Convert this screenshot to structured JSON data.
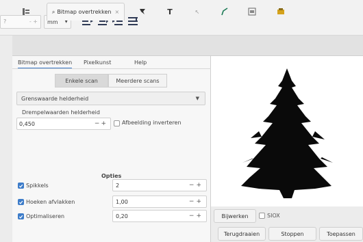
{
  "toolbar": {
    "unit_spin_value": "?",
    "unit_select": "mm",
    "icons": [
      "align-left-icon",
      "align-center-icon",
      "align-right-icon",
      "align-justify-icon"
    ]
  },
  "tabs": {
    "active_label": "Bitmap overtrekken",
    "icons": [
      "layers-icon",
      "trace-bitmap-icon",
      "brush-icon",
      "text-tool-icon",
      "pointer-icon",
      "pen-icon",
      "dialog-icon",
      "paint-icon"
    ]
  },
  "subtabs": [
    "Bitmap overtrekken",
    "Pixelkunst",
    "Help"
  ],
  "scan_modes": [
    "Enkele scan",
    "Meerdere scans"
  ],
  "mode_dropdown": "Grenswaarde helderheid",
  "threshold": {
    "label": "Drempelwaarden helderheid",
    "value": "0,450",
    "invert_label": "Afbeelding inverteren"
  },
  "options": {
    "title": "Opties",
    "rows": [
      {
        "label": "Spikkels",
        "value": "2"
      },
      {
        "label": "Hoeken afvlakken",
        "value": "1,00"
      },
      {
        "label": "Optimaliseren",
        "value": "0,20"
      }
    ]
  },
  "preview": {
    "update_button": "Bijwerken",
    "siox_label": "SIOX"
  },
  "footer": {
    "reset_button": "Terugdraaien",
    "stop_button": "Stoppen",
    "apply_button": "Toepassen"
  },
  "colors": {
    "accent": "#3d7cc9",
    "tree": "#0a0a0a"
  }
}
